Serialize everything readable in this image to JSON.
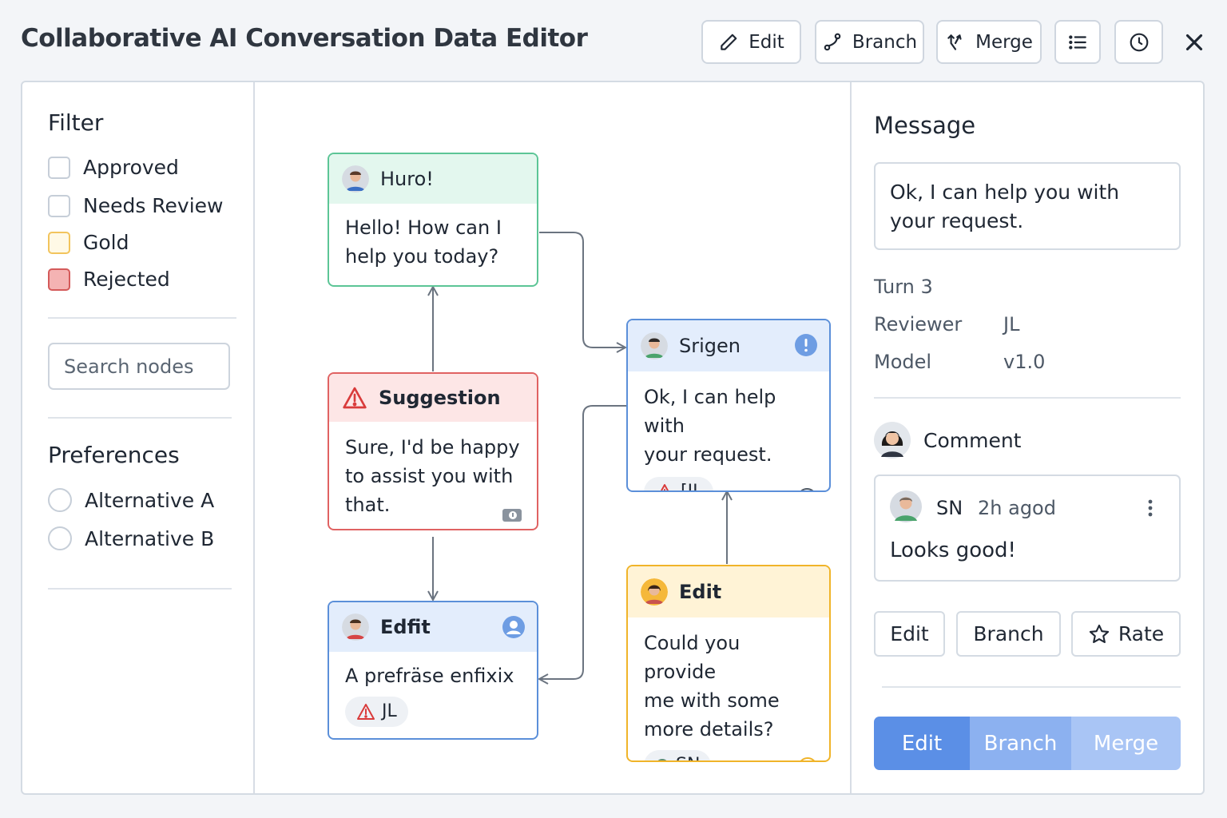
{
  "app": {
    "title": "Collaborative AI Conversation Data Editor"
  },
  "toolbar": {
    "edit_label": "Edit",
    "branch_label": "Branch",
    "merge_label": "Merge",
    "list_icon": "list-icon",
    "history_icon": "clock-icon",
    "close_icon": "close-icon"
  },
  "sidebar": {
    "filter_heading": "Filter",
    "filters": [
      {
        "label": "Approved",
        "style": "default"
      },
      {
        "label": "Needs Review",
        "style": "default"
      },
      {
        "label": "Gold",
        "style": "gold"
      },
      {
        "label": "Rejected",
        "style": "rejected"
      }
    ],
    "search_placeholder": "Search nodes",
    "preferences_heading": "Preferences",
    "preferences": [
      {
        "label": "Alternative A"
      },
      {
        "label": "Alternative B"
      }
    ]
  },
  "graph": {
    "nodes": [
      {
        "id": "huro",
        "title": "Huro!",
        "text_lines": [
          "Hello! How can I",
          "help you today?"
        ],
        "color": "#4fbf8c",
        "head_bg": "#e3f7ee"
      },
      {
        "id": "suggestion",
        "title": "Suggestion",
        "text_lines": [
          "Sure, I'd be happy",
          "to assist you with",
          "that."
        ],
        "color": "#e06262",
        "head_bg": "#fde6e6"
      },
      {
        "id": "edfit",
        "title": "Edfit",
        "text_lines": [
          "A prefräse enfixix"
        ],
        "tag": "JL",
        "color": "#5b8fd9",
        "head_bg": "#e3edfc"
      },
      {
        "id": "srigen",
        "title": "Srigen",
        "text_lines": [
          "Ok, I can help with",
          "your request."
        ],
        "tag": "[IL",
        "color": "#5b8fd9",
        "head_bg": "#e3edfc"
      },
      {
        "id": "edit",
        "title": "Edit",
        "text_lines": [
          "Could you provide",
          "me with some",
          "more details?"
        ],
        "tag": "SN",
        "color": "#f0b429",
        "head_bg": "#fff3d6"
      }
    ]
  },
  "panel": {
    "title": "Message",
    "message_lines": [
      "Ok, I can help you with",
      "your request."
    ],
    "turn": "Turn 3",
    "reviewer_label": "Reviewer",
    "reviewer_value": "JL",
    "model_label": "Model",
    "model_value": "v1.0",
    "comment_heading": "Comment",
    "comment": {
      "author": "SN",
      "time": "2h agod",
      "text": "Looks good!"
    },
    "actions": {
      "edit": "Edit",
      "branch": "Branch",
      "rate": "Rate"
    },
    "segmented": {
      "edit": "Edit",
      "branch": "Branch",
      "merge": "Merge"
    }
  },
  "colors": {
    "accent_blue": "#5b8fe6",
    "seg_mid": "#8cb1f0",
    "seg_light": "#a9c5f5",
    "arrow": "#6b7480"
  }
}
